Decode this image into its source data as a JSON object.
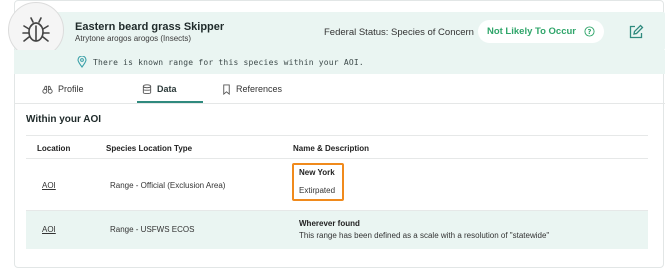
{
  "species": {
    "common_name": "Eastern beard grass Skipper",
    "scientific_name": "Atrytone arogos arogos (Insects)",
    "federal_status": "Federal Status: Species of Concern",
    "determination": "Not Likely To Occur",
    "icon": "bug-icon"
  },
  "range_note": "There is known range for this species within your AOI.",
  "tabs": [
    {
      "label": "Profile",
      "icon": "binoculars-icon"
    },
    {
      "label": "Data",
      "icon": "database-icon",
      "active": true
    },
    {
      "label": "References",
      "icon": "bookmark-icon"
    }
  ],
  "section_title": "Within your AOI",
  "table": {
    "headers": [
      "Location",
      "Species Location Type",
      "Name & Description"
    ],
    "rows": [
      {
        "location": "AOI",
        "type": "Range - Official (Exclusion Area)",
        "name": "New York",
        "description": "Extirpated"
      },
      {
        "location": "AOI",
        "type": "Range - USFWS ECOS",
        "name": "Wherever found",
        "description": "This range has been defined as a scale with a resolution of \"statewide\""
      }
    ]
  },
  "colors": {
    "header_bg": "#eaf5f2",
    "status_green": "#2fa56a",
    "accent_teal": "#2f8a7e",
    "highlight_orange": "#f08a1c"
  }
}
